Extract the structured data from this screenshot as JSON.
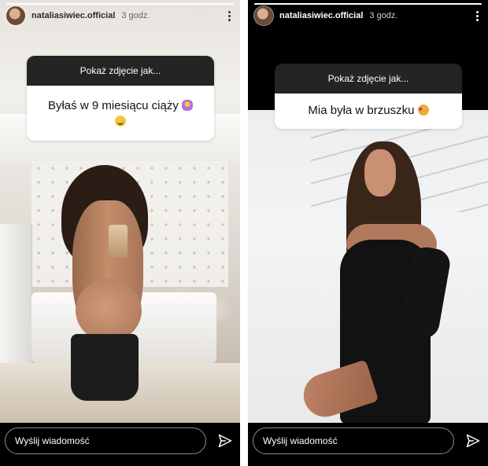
{
  "stories": [
    {
      "username": "nataliasiwiec.official",
      "time": "3 godz.",
      "question": {
        "header": "Pokaż zdjęcie jak...",
        "answer": "Byłaś w 9 miesiącu ciąży",
        "emojis": [
          "pregnant-emoji",
          "smiling-face-emoji"
        ]
      },
      "reply_placeholder": "Wyślij wiadomość"
    },
    {
      "username": "nataliasiwiec.official",
      "time": "3 godz.",
      "question": {
        "header": "Pokaż zdjęcie jak...",
        "answer": "Mia była w brzuszku",
        "emojis": [
          "smiling-face-with-hearts-emoji"
        ]
      },
      "reply_placeholder": "Wyślij wiadomość"
    }
  ],
  "icons": [
    "avatar",
    "more-options-icon",
    "send-icon"
  ],
  "colors": {
    "sticker_header": "#242424",
    "sticker_body": "#ffffff",
    "bar": "#000000"
  }
}
